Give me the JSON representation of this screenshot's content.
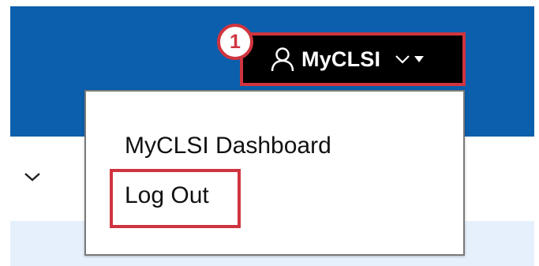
{
  "header": {
    "account_menu": {
      "label": "MyCLSI",
      "icon": "user-icon",
      "expand_icon": "chevron-down-icon",
      "caret_icon": "caret-down-icon"
    },
    "step_badge": "1"
  },
  "dropdown": {
    "items": [
      {
        "label": "MyCLSI Dashboard"
      },
      {
        "label": "Log Out"
      }
    ]
  },
  "colors": {
    "header_bg": "#0b5fad",
    "account_button_bg": "#000000",
    "highlight": "#d0343f",
    "light_band": "#e5f0fc"
  }
}
